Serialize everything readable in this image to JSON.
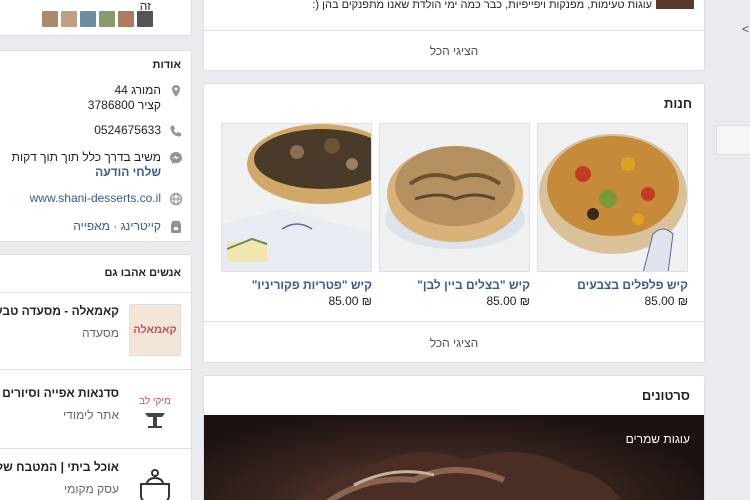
{
  "top": {
    "letter": "זה",
    "avatar_colors": [
      "#a88b6f",
      "#c0a080",
      "#6b8e9f",
      "#8a9a6a",
      "#b07a60",
      "#555"
    ]
  },
  "about": {
    "heading": "אודות",
    "address_line1": "המורג 44",
    "address_line2": "קציר 3786800",
    "phone": "0524675633",
    "message_line1": "משיב בדרך כלל תוך תוך דקות",
    "message_link": "שלחי הודעה",
    "website": "www.shani-desserts.co.il",
    "categories": "קייטרינג · מאפייה",
    "icons": [
      "location-icon",
      "phone-icon",
      "messenger-icon",
      "globe-icon",
      "category-icon"
    ]
  },
  "liked": {
    "heading": "אנשים אהבו גם",
    "items": [
      {
        "name": "קאמאלה - מסעדה טבעונית",
        "category": "מסעדה"
      },
      {
        "name": "סדנאות אפייה וסיורים",
        "category": "אתר לימודי"
      },
      {
        "name": "אוכל ביתי | המטבח של",
        "category": "עסק מקומי"
      }
    ]
  },
  "posts": {
    "text": "עוגות טעימות, מפנקות ויפייפיות, כבר כמה ימי הולדת שאנו מתפנקים בהן (:",
    "see_all": "הציגי הכל"
  },
  "shop": {
    "title": "חנות",
    "see_all": "הציגי הכל",
    "products": [
      {
        "name": "קיש פלפלים בצבעים",
        "price": "85.00 ₪"
      },
      {
        "name": "קיש \"בצלים ביין לבן\"",
        "price": "85.00 ₪"
      },
      {
        "name": "קיש \"פטריות פקוריניו\"",
        "price": "85.00 ₪"
      }
    ]
  },
  "videos": {
    "title": "סרטונים",
    "label": "עוגות שמרים"
  },
  "right": {
    "arrow": "<"
  }
}
